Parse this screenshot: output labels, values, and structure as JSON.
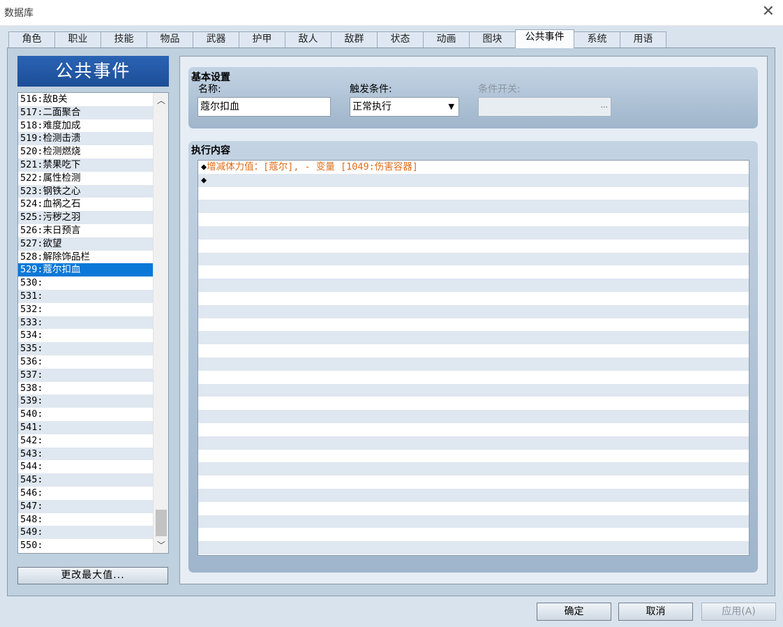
{
  "window": {
    "title": "数据库",
    "close_glyph": "✕"
  },
  "tabs": [
    {
      "label": "角色"
    },
    {
      "label": "职业"
    },
    {
      "label": "技能"
    },
    {
      "label": "物品"
    },
    {
      "label": "武器"
    },
    {
      "label": "护甲"
    },
    {
      "label": "敌人"
    },
    {
      "label": "敌群"
    },
    {
      "label": "状态"
    },
    {
      "label": "动画"
    },
    {
      "label": "图块"
    },
    {
      "label": "公共事件"
    },
    {
      "label": "系统"
    },
    {
      "label": "用语"
    }
  ],
  "active_tab": "公共事件",
  "list": {
    "header": "公共事件",
    "selected": "529:蔻尔扣血",
    "items": [
      "516:敌B关",
      "517:二面聚合",
      "518:难度加成",
      "519:检测击溃",
      "520:检测燃烧",
      "521:禁果吃下",
      "522:属性检测",
      "523:钢铁之心",
      "524:血祸之石",
      "525:污秽之羽",
      "526:末日预言",
      "527:欲望",
      "528:解除饰品栏",
      "529:蔻尔扣血",
      "530:",
      "531:",
      "532:",
      "533:",
      "534:",
      "535:",
      "536:",
      "537:",
      "538:",
      "539:",
      "540:",
      "541:",
      "542:",
      "543:",
      "544:",
      "545:",
      "546:",
      "547:",
      "548:",
      "549:",
      "550:"
    ],
    "change_max_button": "更改最大值..."
  },
  "basic": {
    "title": "基本设置",
    "name_label": "名称:",
    "name_value": "蔻尔扣血",
    "trigger_label": "触发条件:",
    "trigger_value": "正常执行",
    "switch_label": "条件开关:",
    "switch_value": "",
    "switch_button": "..."
  },
  "exec": {
    "title": "执行内容",
    "lines": [
      {
        "marker": "◆",
        "text": "增减体力值：[蔻尔], - 变量 [1049:伤害容器]"
      },
      {
        "marker": "◆",
        "text": ""
      }
    ],
    "command_color": "#e06d19"
  },
  "buttons": {
    "ok": "确定",
    "cancel": "取消",
    "apply": "应用(A)"
  },
  "colors": {
    "selection": "#0b78d7",
    "header_blue": "#2a63b4",
    "row_alt": "#dfe7f0"
  },
  "icons": {
    "close": "close-icon",
    "scroll_up": "chevron-up-icon",
    "scroll_down": "chevron-down-icon",
    "dropdown": "caret-down-icon"
  }
}
